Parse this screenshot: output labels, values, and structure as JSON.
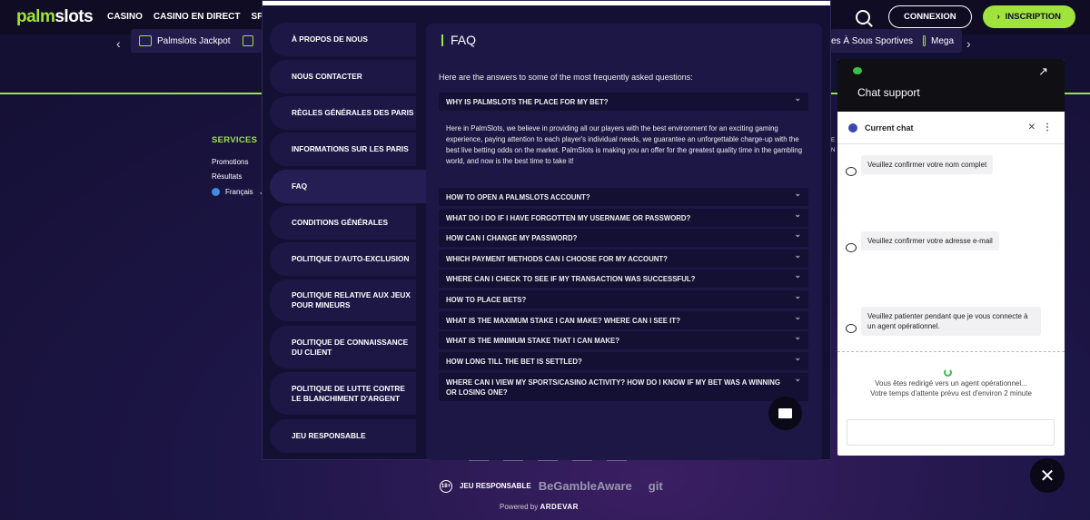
{
  "brand": {
    "logo": "palm",
    "logo_dot": "slots"
  },
  "nav": {
    "items": [
      "CASINO",
      "CASINO EN DIRECT",
      "SPORT"
    ],
    "login": "CONNEXION",
    "signup": "INSCRIPTION"
  },
  "subnav": {
    "left_item": "Palmslots Jackpot",
    "right_item1": "es À Sous Sportives",
    "right_item2": "Mega"
  },
  "footer_bg": {
    "services_title": "SERVICES",
    "links": [
      "Promotions",
      "Résultats"
    ],
    "language": "Français"
  },
  "footer": {
    "age_badge": "18+",
    "responsible": "JEU RESPONSABLE",
    "gamble_aware": "BeGambleAware",
    "git_logo": "git",
    "powered_by": "Powered by",
    "powered_brand": "ARDEVAR"
  },
  "modal": {
    "nav": [
      "À propos de nous",
      "Nous contacter",
      "Règles générales des paris",
      "Informations sur les paris",
      "FAQ",
      "Conditions générales",
      "Politique d'auto-exclusion",
      "Politique relative aux jeux pour mineurs",
      "Politique de connaissance du client",
      "Politique de lutte contre le blanchiment d'argent",
      "Jeu responsable"
    ],
    "active": "FAQ",
    "title": "FAQ",
    "intro": "Here are the answers to some of the most frequently asked questions:",
    "first_question": "Why is PalmSlots the place for my bet?",
    "first_answer": "Here in PalmSlots, we believe in providing all our players with the best environment for an exciting gaming experience, paying attention to each player's individual needs, we guarantee an unforgettable charge-up with the best live betting odds on the market. PalmSlots is making you an offer for the greatest quality time in the gambling world, and now is the best time to take it!",
    "questions": [
      "How to open a PalmSlots account?",
      "What do I do if I have forgotten my username or password?",
      "How can I change my password?",
      "Which payment methods can I choose for my account?",
      "Where can I check to see if my transaction was successful?",
      "How to place bets?",
      "What is the maximum stake I can make? Where can I see it?",
      "What is the minimum stake that I can make?",
      "How long till the bet is settled?",
      "Where can I view my sports/casino activity? How do I know if my bet was a winning or losing one?"
    ]
  },
  "chat": {
    "title": "Chat support",
    "current": "Current chat",
    "messages": [
      "Veuillez confirmer votre nom complet",
      "Veuillez confirmer votre adresse e-mail",
      "Veuillez patienter pendant que je vous connecte à un agent opérationnel."
    ],
    "wait_line1": "Vous êtes redirigé vers un agent opérationnel...",
    "wait_line2": "Votre temps d'attente prévu est d'environ 2 minute"
  }
}
